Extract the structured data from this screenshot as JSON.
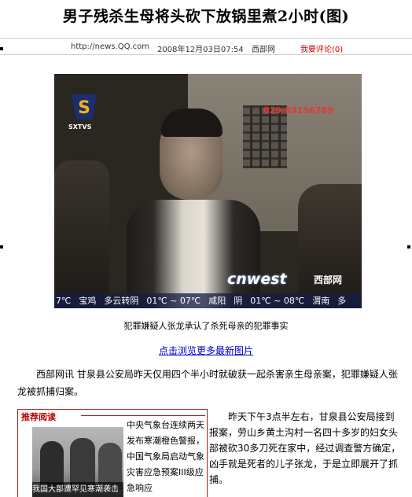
{
  "article": {
    "title": "男子残杀生母将头砍下放锅里煮2小时(图)",
    "meta": {
      "url": "http://news.QQ.com",
      "date": "2008年12月03日07:54",
      "source": "西部网",
      "comment": "我要评论(0)"
    },
    "photo": {
      "channel_logo": "SXTVS",
      "phone": "029-83156789",
      "brand": "cnwest",
      "brand_cn": "西部网",
      "ticker": [
        "7℃",
        "宝鸡",
        "多云转阴",
        "01℃ ~ 07℃",
        "咸阳",
        "阴",
        "01℃ ~ 08℃",
        "渭南",
        "多"
      ]
    },
    "caption": "犯罪嫌疑人张龙承认了杀死母亲的犯罪事实",
    "more_link": "点击浏览更多最新图片",
    "paragraph1": "西部网讯 甘泉县公安局昨天仅用四个半小时就破获一起杀害亲生母亲案，犯罪嫌疑人张龙被抓捕归案。",
    "recommend": {
      "title": "推荐阅读",
      "thumb_caption": "我国大部遭罕见寒潮袭击",
      "text": "中央气象台连续两天发布寒潮橙色警报，中国气象局启动气象灾害应急预案III级应急响应"
    },
    "paragraph2": "昨天下午3点半左右，甘泉县公安局接到报案，劳山乡黄土沟村一名四十多岁的妇女头部被砍30多刀死在家中，经过调查警方确定，凶手就是死者的儿子张龙，于是立即展开了抓捕。"
  }
}
